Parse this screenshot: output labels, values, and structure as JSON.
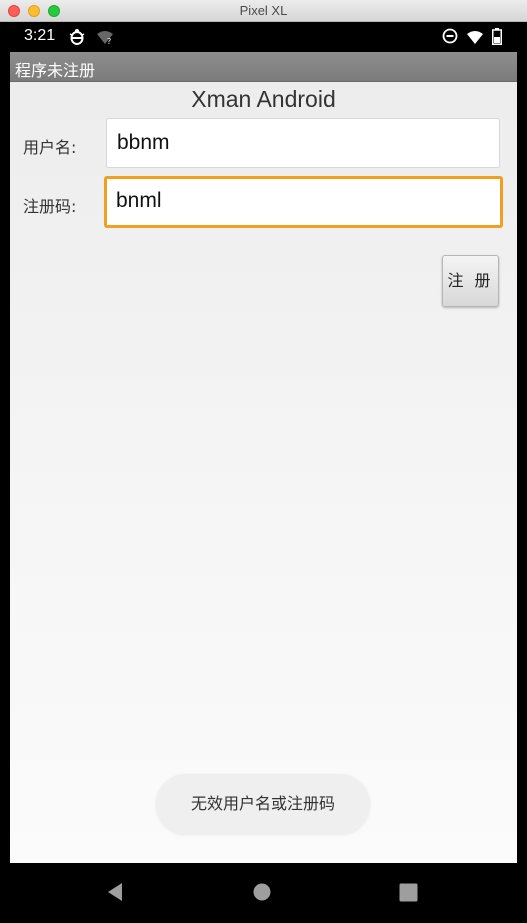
{
  "window": {
    "title": "Pixel XL"
  },
  "status_bar": {
    "time": "3:21",
    "icons": [
      "debug-icon",
      "wifi-question-icon",
      "dnd-icon",
      "wifi-x-icon",
      "battery-icon"
    ]
  },
  "app": {
    "action_bar_title": "程序未注册",
    "heading": "Xman Android",
    "username": {
      "label": "用户名:",
      "value": "bbnm"
    },
    "regcode": {
      "label": "注册码:",
      "value": "bnml"
    },
    "register_button": "注 册",
    "toast": "无效用户名或注册码"
  },
  "nav_bar": {
    "icons": [
      "back-icon",
      "home-icon",
      "recents-icon"
    ]
  },
  "colors": {
    "focus": "#f0a01e",
    "action_bar": "#858585"
  }
}
